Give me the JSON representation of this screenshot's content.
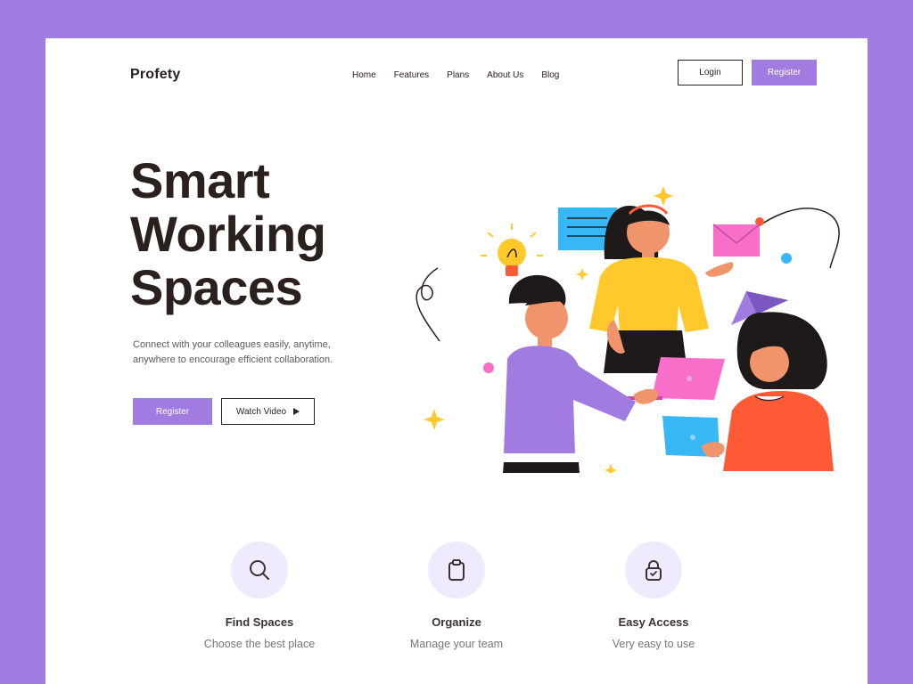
{
  "header": {
    "logo": "Profety",
    "nav": [
      "Home",
      "Features",
      "Plans",
      "About Us",
      "Blog"
    ],
    "login_label": "Login",
    "register_label": "Register"
  },
  "hero": {
    "title_line1": "Smart",
    "title_line2": "Working",
    "title_line3": "Spaces",
    "subtitle": "Connect with your colleagues easily, anytime, anywhere to encourage efficient collaboration.",
    "register_label": "Register",
    "watch_label": "Watch Video",
    "illustration": "team-collaboration-illustration"
  },
  "features": [
    {
      "icon": "search-icon",
      "title": "Find Spaces",
      "desc": "Choose the best place"
    },
    {
      "icon": "clipboard-icon",
      "title": "Organize",
      "desc": "Manage your team"
    },
    {
      "icon": "lock-icon",
      "title": "Easy Access",
      "desc": "Very easy to use"
    }
  ],
  "colors": {
    "background": "#a07ce0",
    "accent": "#a07ce0",
    "text": "#2a211f",
    "icon_circle": "#efeafd",
    "yellow": "#ffc92b",
    "blue": "#37b7f5",
    "pink": "#f76fc9",
    "orange": "#ff5a36"
  }
}
